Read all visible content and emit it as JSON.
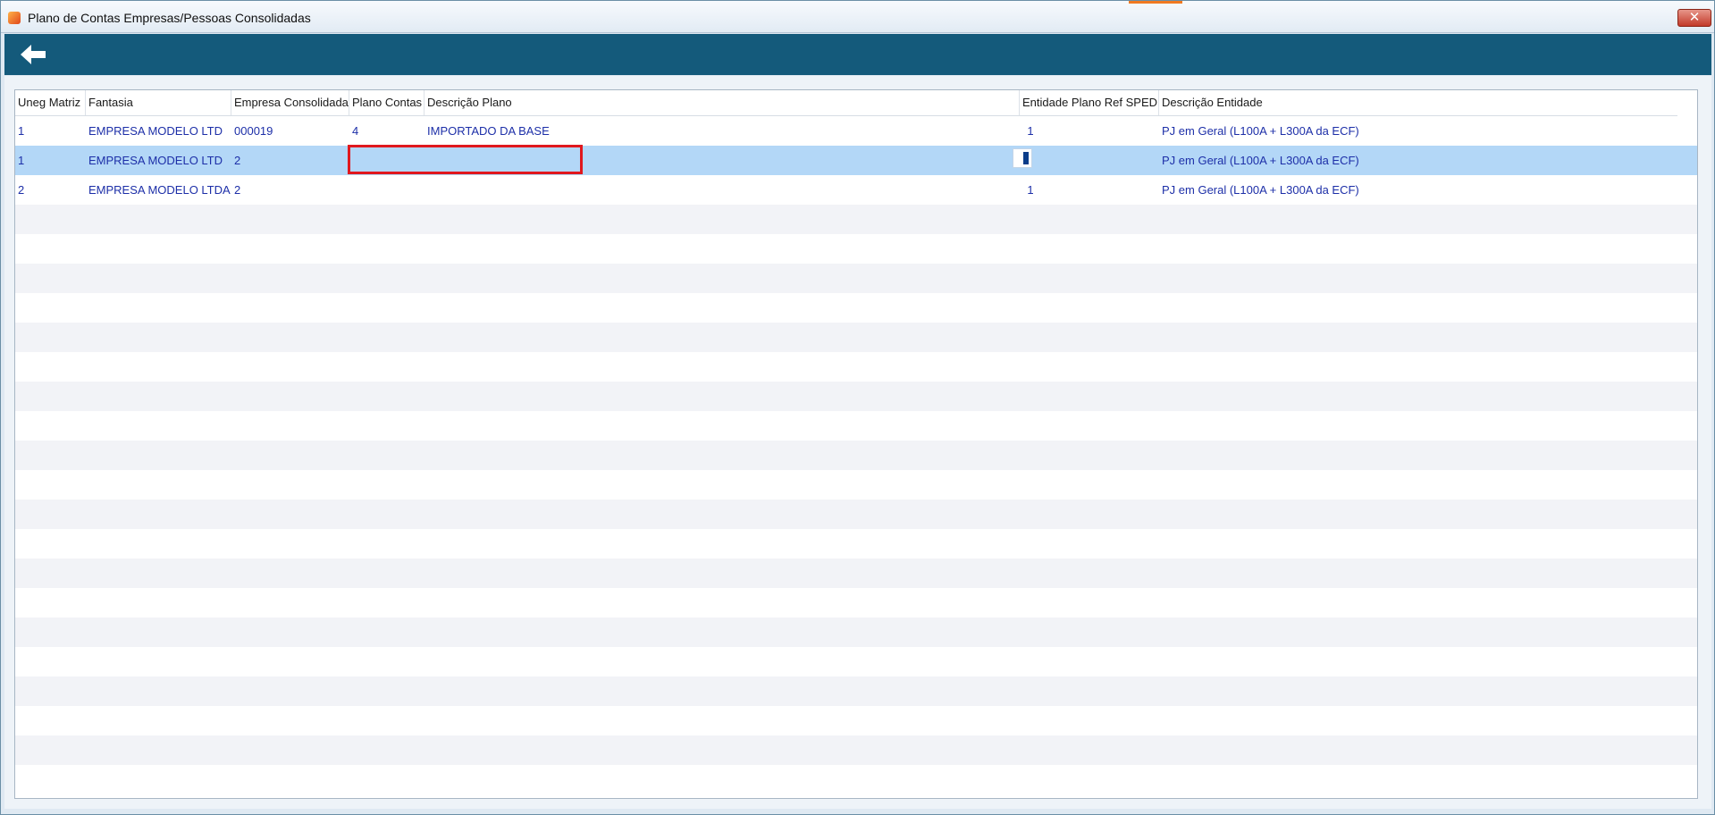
{
  "window": {
    "title": "Plano de Contas Empresas/Pessoas Consolidadas",
    "close_label": "✕"
  },
  "toolbar": {
    "back_icon": "arrow-left-icon"
  },
  "grid": {
    "columns": [
      {
        "key": "uneg_matriz",
        "label": "Uneg Matriz"
      },
      {
        "key": "fantasia",
        "label": "Fantasia"
      },
      {
        "key": "empresa_consolidada",
        "label": "Empresa Consolidada"
      },
      {
        "key": "plano_contas",
        "label": "Plano Contas"
      },
      {
        "key": "descricao_plano",
        "label": "Descrição Plano"
      },
      {
        "key": "entidade_plano_ref_sped",
        "label": "Entidade Plano Ref SPED"
      },
      {
        "key": "descricao_entidade",
        "label": "Descrição Entidade"
      }
    ],
    "rows": [
      {
        "uneg_matriz": "1",
        "fantasia": "EMPRESA MODELO LTD",
        "empresa_consolidada": "000019",
        "plano_contas": "4",
        "descricao_plano": "IMPORTADO DA BASE",
        "entidade_plano_ref_sped": "1",
        "descricao_entidade": "PJ em Geral (L100A + L300A da ECF)"
      },
      {
        "uneg_matriz": "1",
        "fantasia": "EMPRESA MODELO LTD",
        "empresa_consolidada": "2",
        "plano_contas": "",
        "descricao_plano": "",
        "entidade_plano_ref_sped": "",
        "descricao_entidade": "PJ em Geral (L100A + L300A da ECF)"
      },
      {
        "uneg_matriz": "2",
        "fantasia": "EMPRESA MODELO LTDA",
        "empresa_consolidada": "2",
        "plano_contas": "",
        "descricao_plano": "",
        "entidade_plano_ref_sped": "1",
        "descricao_entidade": "PJ em Geral (L100A + L300A da ECF)"
      }
    ]
  },
  "colors": {
    "toolbar": "#145a7b",
    "selected_row": "#b3d7f7",
    "alt_row": "#f2f3f7",
    "row_text": "#1d2fa8",
    "highlight": "#e0181e"
  }
}
